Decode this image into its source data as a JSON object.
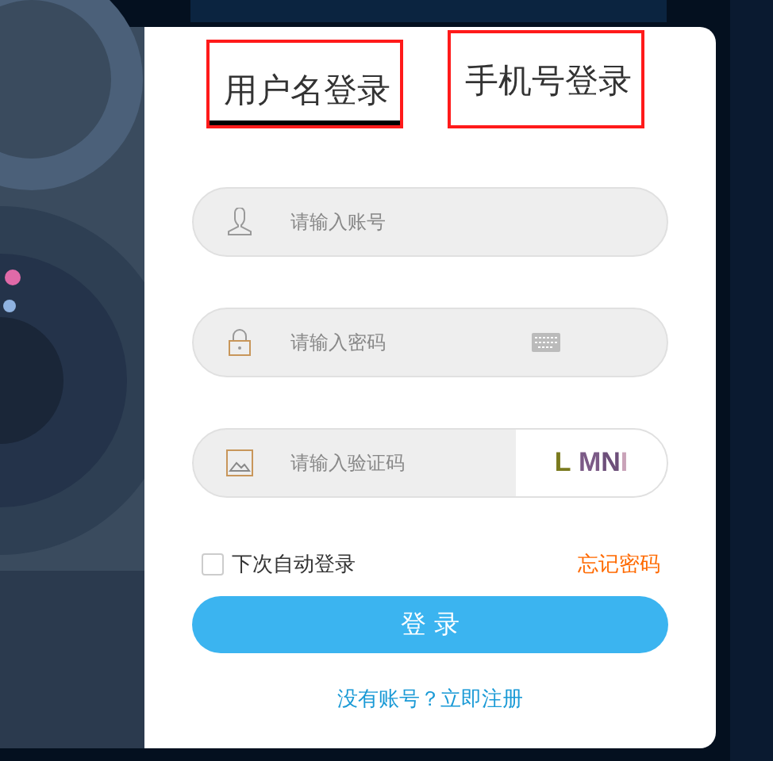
{
  "tabs": [
    {
      "label": "用户名登录",
      "selected": true,
      "highlighted": true
    },
    {
      "label": "手机号登录",
      "selected": false,
      "highlighted": true
    }
  ],
  "fields": [
    {
      "kind": "account",
      "placeholder": "请输入账号"
    },
    {
      "kind": "password",
      "placeholder": "请输入密码"
    },
    {
      "kind": "captcha",
      "placeholder": "请输入验证码",
      "captcha": "L MNI"
    }
  ],
  "remember": {
    "label": "下次自动登录",
    "checked": false
  },
  "forgot_link": "忘记密码",
  "login_button": "登 录",
  "register_link": "没有账号？立即注册"
}
